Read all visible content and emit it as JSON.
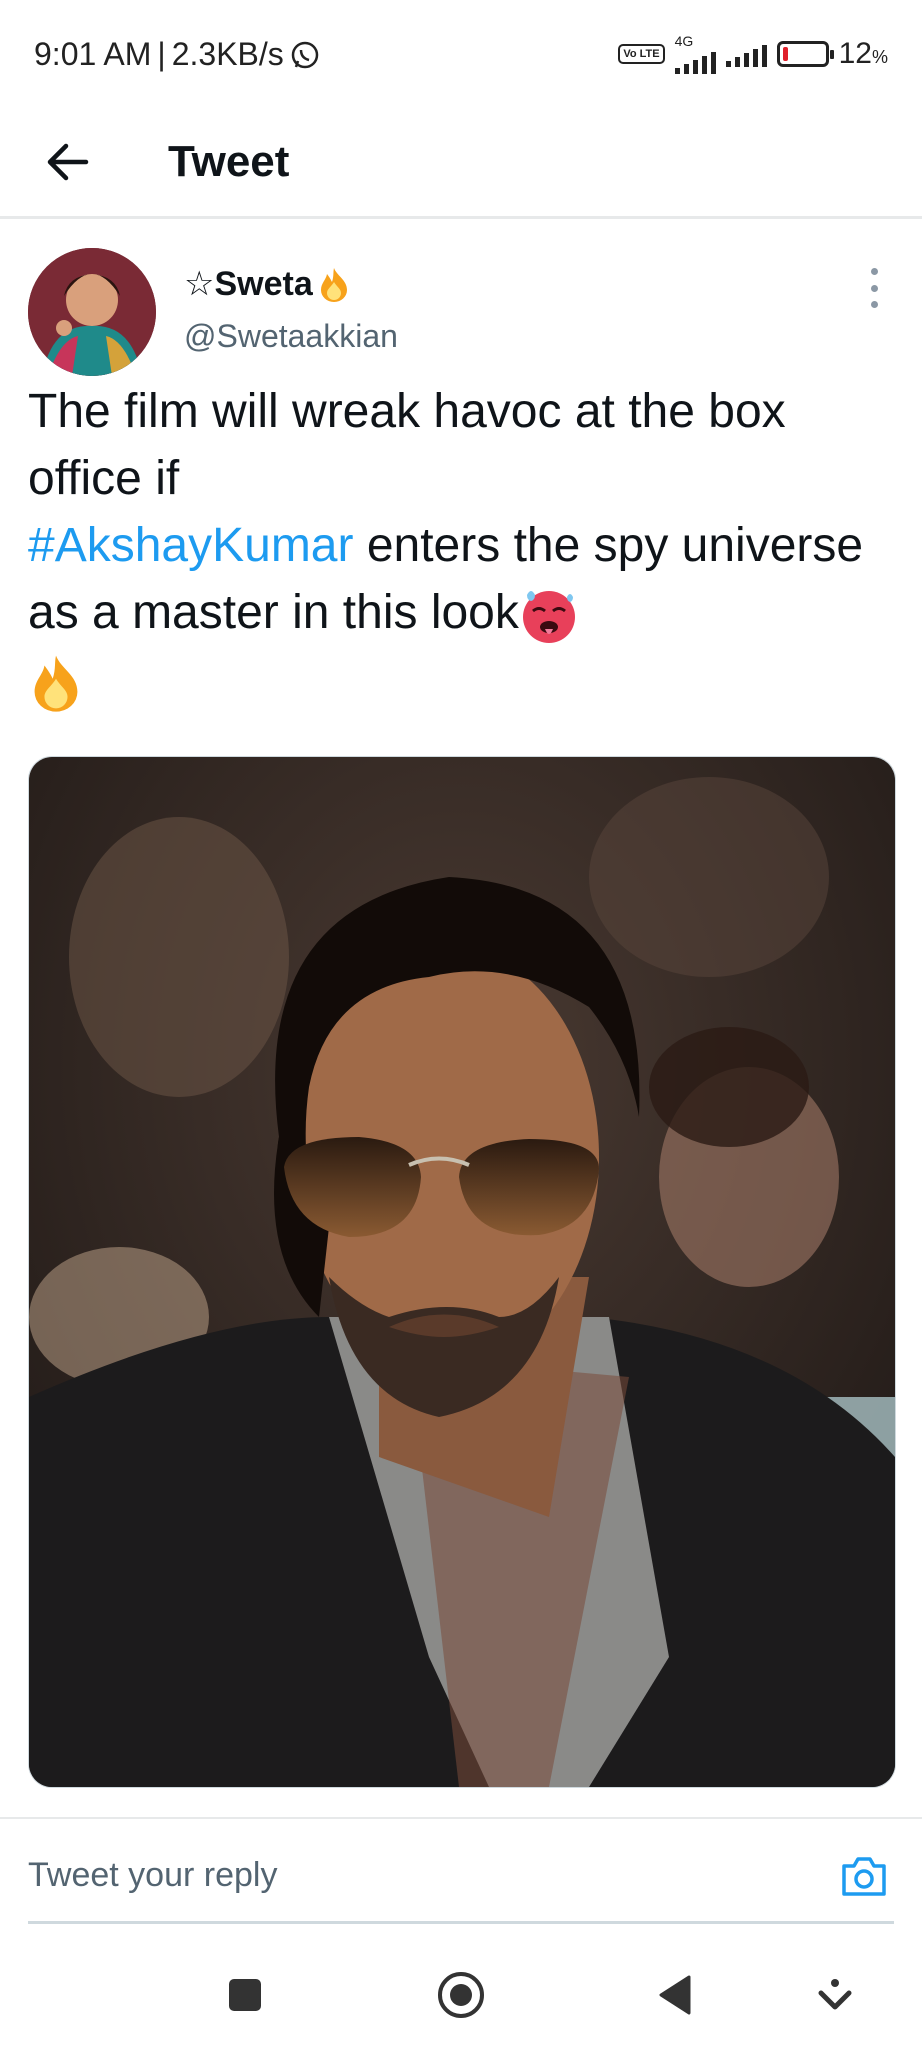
{
  "status_bar": {
    "time": "9:01 AM",
    "speed": "2.3KB/s",
    "network_type": "4G",
    "volte": "Vo LTE",
    "battery_percent": "12",
    "battery_unit": "%",
    "battery_level": 0.12,
    "icons": [
      "whatsapp-icon",
      "volte-icon",
      "signal-icon",
      "battery-icon"
    ]
  },
  "header": {
    "title": "Tweet",
    "back_icon": "arrow-left-icon"
  },
  "tweet": {
    "author_name": "☆Sweta",
    "author_handle": "@Swetaakkian",
    "text_part1": "The film will wreak havoc at the box office if",
    "hashtag": "#AkshayKumar",
    "text_part2": " enters the spy universe as a master in this look",
    "emojis": [
      "fire-emoji",
      "hot-face-emoji"
    ]
  },
  "reply": {
    "placeholder": "Tweet your reply",
    "camera_icon": "camera-icon"
  },
  "colors": {
    "accent": "#1d9bf0",
    "text": "#0f1419",
    "muted": "#536471"
  },
  "navbar": {
    "icons": [
      "square-icon",
      "circle-home-icon",
      "triangle-back-icon",
      "down-arrow-icon"
    ]
  }
}
